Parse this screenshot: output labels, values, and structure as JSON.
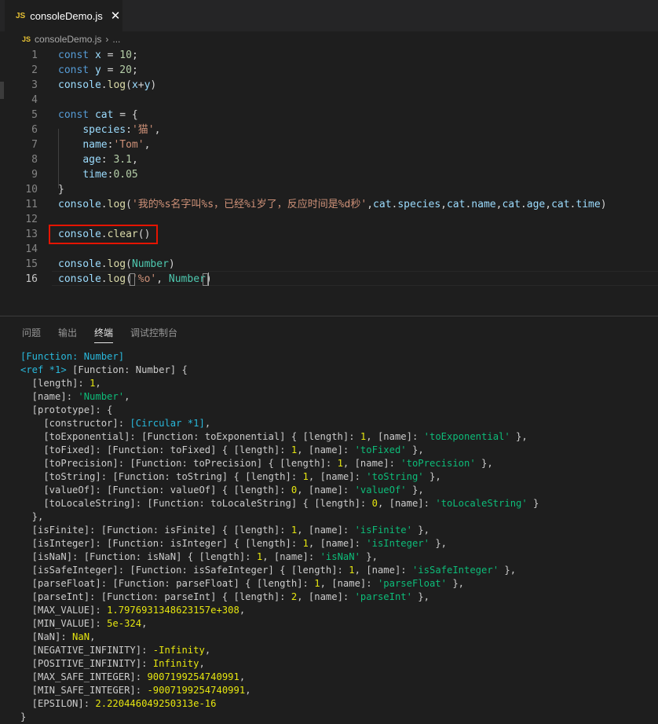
{
  "tab": {
    "icon_label": "JS",
    "filename": "consoleDemo.js",
    "close_glyph": "✕"
  },
  "breadcrumb": {
    "icon_label": "JS",
    "file": "consoleDemo.js",
    "separator": "›",
    "more": "..."
  },
  "editor": {
    "active_line": 16,
    "line_numbers": [
      "1",
      "2",
      "3",
      "4",
      "5",
      "6",
      "7",
      "8",
      "9",
      "10",
      "11",
      "12",
      "13",
      "14",
      "15",
      "16"
    ],
    "lines": [
      [
        [
          "k",
          "const "
        ],
        [
          "v",
          "x"
        ],
        [
          "p",
          " = "
        ],
        [
          "n",
          "10"
        ],
        [
          "p",
          ";"
        ]
      ],
      [
        [
          "k",
          "const "
        ],
        [
          "v",
          "y"
        ],
        [
          "p",
          " = "
        ],
        [
          "n",
          "20"
        ],
        [
          "p",
          ";"
        ]
      ],
      [
        [
          "v",
          "console"
        ],
        [
          "p",
          "."
        ],
        [
          "f",
          "log"
        ],
        [
          "p",
          "("
        ],
        [
          "v",
          "x"
        ],
        [
          "p",
          "+"
        ],
        [
          "v",
          "y"
        ],
        [
          "p",
          ")"
        ]
      ],
      [],
      [
        [
          "k",
          "const "
        ],
        [
          "v",
          "cat"
        ],
        [
          "p",
          " = {"
        ]
      ],
      [
        [
          "p",
          "    "
        ],
        [
          "v",
          "species"
        ],
        [
          "p",
          ":"
        ],
        [
          "s",
          "'猫'"
        ],
        [
          "p",
          ","
        ]
      ],
      [
        [
          "p",
          "    "
        ],
        [
          "v",
          "name"
        ],
        [
          "p",
          ":"
        ],
        [
          "s",
          "'Tom'"
        ],
        [
          "p",
          ","
        ]
      ],
      [
        [
          "p",
          "    "
        ],
        [
          "v",
          "age"
        ],
        [
          "p",
          ": "
        ],
        [
          "n",
          "3.1"
        ],
        [
          "p",
          ","
        ]
      ],
      [
        [
          "p",
          "    "
        ],
        [
          "v",
          "time"
        ],
        [
          "p",
          ":"
        ],
        [
          "n",
          "0.05"
        ]
      ],
      [
        [
          "p",
          "}"
        ]
      ],
      [
        [
          "v",
          "console"
        ],
        [
          "p",
          "."
        ],
        [
          "f",
          "log"
        ],
        [
          "p",
          "("
        ],
        [
          "s",
          "'我的%s名字叫%s，已经%i岁了，反应时间是%d秒'"
        ],
        [
          "p",
          ","
        ],
        [
          "v",
          "cat"
        ],
        [
          "p",
          "."
        ],
        [
          "v",
          "species"
        ],
        [
          "p",
          ","
        ],
        [
          "v",
          "cat"
        ],
        [
          "p",
          "."
        ],
        [
          "v",
          "name"
        ],
        [
          "p",
          ","
        ],
        [
          "v",
          "cat"
        ],
        [
          "p",
          "."
        ],
        [
          "v",
          "age"
        ],
        [
          "p",
          ","
        ],
        [
          "v",
          "cat"
        ],
        [
          "p",
          "."
        ],
        [
          "v",
          "time"
        ],
        [
          "p",
          ")"
        ]
      ],
      [],
      [
        [
          "v",
          "console"
        ],
        [
          "p",
          "."
        ],
        [
          "f",
          "clear"
        ],
        [
          "p",
          "()"
        ]
      ],
      [],
      [
        [
          "v",
          "console"
        ],
        [
          "p",
          "."
        ],
        [
          "f",
          "log"
        ],
        [
          "p",
          "("
        ],
        [
          "t",
          "Number"
        ],
        [
          "p",
          ")"
        ]
      ],
      [
        [
          "v",
          "console"
        ],
        [
          "p",
          "."
        ],
        [
          "f",
          "log"
        ],
        [
          "p",
          "("
        ],
        [
          "s",
          "'%o'"
        ],
        [
          "p",
          ", "
        ],
        [
          "t",
          "Number"
        ],
        [
          "p",
          ")"
        ]
      ]
    ]
  },
  "panel": {
    "tabs": [
      "问题",
      "输出",
      "终端",
      "调试控制台"
    ],
    "active_tab": "终端"
  },
  "terminal": {
    "lines": [
      [
        [
          "c",
          "[Function: Number]"
        ]
      ],
      [
        [
          "c",
          "<ref *1> "
        ],
        [
          "w",
          "[Function: Number] {"
        ]
      ],
      [
        [
          "w",
          "  [length]: "
        ],
        [
          "y",
          "1"
        ],
        [
          "w",
          ","
        ]
      ],
      [
        [
          "w",
          "  [name]: "
        ],
        [
          "g",
          "'Number'"
        ],
        [
          "w",
          ","
        ]
      ],
      [
        [
          "w",
          "  [prototype]: {"
        ]
      ],
      [
        [
          "w",
          "    [constructor]: "
        ],
        [
          "c",
          "[Circular *1]"
        ],
        [
          "w",
          ","
        ]
      ],
      [
        [
          "w",
          "    [toExponential]: [Function: toExponential] { [length]: "
        ],
        [
          "y",
          "1"
        ],
        [
          "w",
          ", [name]: "
        ],
        [
          "g",
          "'toExponential'"
        ],
        [
          "w",
          " },"
        ]
      ],
      [
        [
          "w",
          "    [toFixed]: [Function: toFixed] { [length]: "
        ],
        [
          "y",
          "1"
        ],
        [
          "w",
          ", [name]: "
        ],
        [
          "g",
          "'toFixed'"
        ],
        [
          "w",
          " },"
        ]
      ],
      [
        [
          "w",
          "    [toPrecision]: [Function: toPrecision] { [length]: "
        ],
        [
          "y",
          "1"
        ],
        [
          "w",
          ", [name]: "
        ],
        [
          "g",
          "'toPrecision'"
        ],
        [
          "w",
          " },"
        ]
      ],
      [
        [
          "w",
          "    [toString]: [Function: toString] { [length]: "
        ],
        [
          "y",
          "1"
        ],
        [
          "w",
          ", [name]: "
        ],
        [
          "g",
          "'toString'"
        ],
        [
          "w",
          " },"
        ]
      ],
      [
        [
          "w",
          "    [valueOf]: [Function: valueOf] { [length]: "
        ],
        [
          "y",
          "0"
        ],
        [
          "w",
          ", [name]: "
        ],
        [
          "g",
          "'valueOf'"
        ],
        [
          "w",
          " },"
        ]
      ],
      [
        [
          "w",
          "    [toLocaleString]: [Function: toLocaleString] { [length]: "
        ],
        [
          "y",
          "0"
        ],
        [
          "w",
          ", [name]: "
        ],
        [
          "g",
          "'toLocaleString'"
        ],
        [
          "w",
          " }"
        ]
      ],
      [
        [
          "w",
          "  },"
        ]
      ],
      [
        [
          "w",
          "  [isFinite]: [Function: isFinite] { [length]: "
        ],
        [
          "y",
          "1"
        ],
        [
          "w",
          ", [name]: "
        ],
        [
          "g",
          "'isFinite'"
        ],
        [
          "w",
          " },"
        ]
      ],
      [
        [
          "w",
          "  [isInteger]: [Function: isInteger] { [length]: "
        ],
        [
          "y",
          "1"
        ],
        [
          "w",
          ", [name]: "
        ],
        [
          "g",
          "'isInteger'"
        ],
        [
          "w",
          " },"
        ]
      ],
      [
        [
          "w",
          "  [isNaN]: [Function: isNaN] { [length]: "
        ],
        [
          "y",
          "1"
        ],
        [
          "w",
          ", [name]: "
        ],
        [
          "g",
          "'isNaN'"
        ],
        [
          "w",
          " },"
        ]
      ],
      [
        [
          "w",
          "  [isSafeInteger]: [Function: isSafeInteger] { [length]: "
        ],
        [
          "y",
          "1"
        ],
        [
          "w",
          ", [name]: "
        ],
        [
          "g",
          "'isSafeInteger'"
        ],
        [
          "w",
          " },"
        ]
      ],
      [
        [
          "w",
          "  [parseFloat]: [Function: parseFloat] { [length]: "
        ],
        [
          "y",
          "1"
        ],
        [
          "w",
          ", [name]: "
        ],
        [
          "g",
          "'parseFloat'"
        ],
        [
          "w",
          " },"
        ]
      ],
      [
        [
          "w",
          "  [parseInt]: [Function: parseInt] { [length]: "
        ],
        [
          "y",
          "2"
        ],
        [
          "w",
          ", [name]: "
        ],
        [
          "g",
          "'parseInt'"
        ],
        [
          "w",
          " },"
        ]
      ],
      [
        [
          "w",
          "  [MAX_VALUE]: "
        ],
        [
          "y",
          "1.7976931348623157e+308"
        ],
        [
          "w",
          ","
        ]
      ],
      [
        [
          "w",
          "  [MIN_VALUE]: "
        ],
        [
          "y",
          "5e-324"
        ],
        [
          "w",
          ","
        ]
      ],
      [
        [
          "w",
          "  [NaN]: "
        ],
        [
          "y",
          "NaN"
        ],
        [
          "w",
          ","
        ]
      ],
      [
        [
          "w",
          "  [NEGATIVE_INFINITY]: "
        ],
        [
          "y",
          "-Infinity"
        ],
        [
          "w",
          ","
        ]
      ],
      [
        [
          "w",
          "  [POSITIVE_INFINITY]: "
        ],
        [
          "y",
          "Infinity"
        ],
        [
          "w",
          ","
        ]
      ],
      [
        [
          "w",
          "  [MAX_SAFE_INTEGER]: "
        ],
        [
          "y",
          "9007199254740991"
        ],
        [
          "w",
          ","
        ]
      ],
      [
        [
          "w",
          "  [MIN_SAFE_INTEGER]: "
        ],
        [
          "y",
          "-9007199254740991"
        ],
        [
          "w",
          ","
        ]
      ],
      [
        [
          "w",
          "  [EPSILON]: "
        ],
        [
          "y",
          "2.220446049250313e-16"
        ]
      ],
      [
        [
          "w",
          "}"
        ]
      ]
    ]
  }
}
